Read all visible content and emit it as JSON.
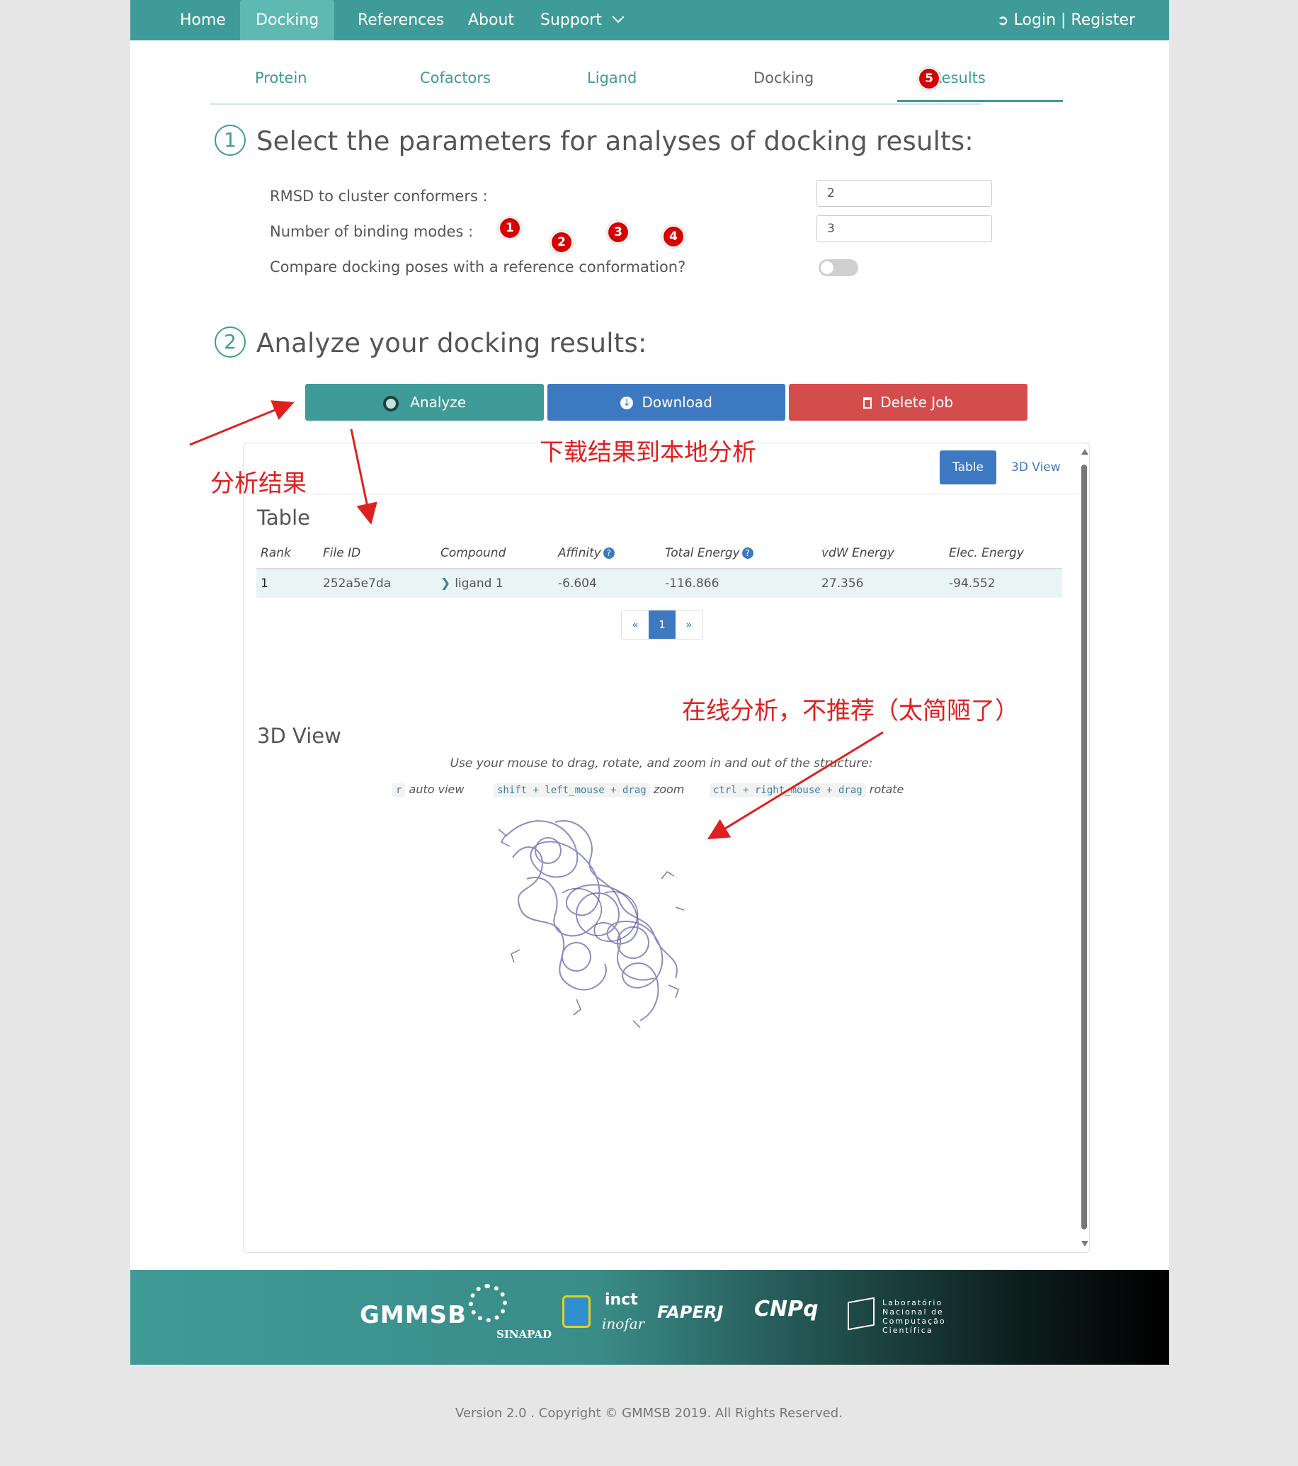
{
  "nav": {
    "items": [
      "Home",
      "Docking",
      "References",
      "About",
      "Support"
    ],
    "login": "Login | Register"
  },
  "steps": [
    "Protein",
    "Cofactors",
    "Ligand",
    "Docking",
    "Results"
  ],
  "section1": {
    "number": "1",
    "title": "Select the parameters for analyses of docking results:"
  },
  "params": {
    "rmsd_label": "RMSD to cluster conformers :",
    "rmsd_value": "2",
    "modes_label": "Number of binding modes :",
    "modes_value": "3",
    "compare_label": "Compare docking poses with a reference conformation?"
  },
  "section2": {
    "number": "2",
    "title": "Analyze your docking results:"
  },
  "buttons": {
    "analyze": "Analyze",
    "download": "Download",
    "delete": "Delete Job"
  },
  "panel": {
    "tab_table": "Table",
    "tab_3d": "3D View",
    "table_heading": "Table",
    "columns": [
      "Rank",
      "File ID",
      "Compound",
      "Affinity",
      "Total Energy",
      "vdW Energy",
      "Elec. Energy"
    ],
    "row": {
      "rank": "1",
      "file_id": "252a5e7da",
      "compound": "ligand 1",
      "affinity": "-6.604",
      "total": "-116.866",
      "vdw": "27.356",
      "elec": "-94.552"
    },
    "pager": {
      "prev": "«",
      "page": "1",
      "next": "»"
    },
    "view_heading": "3D View",
    "hint": "Use your mouse to drag, rotate, and zoom in and out of the structure:",
    "key_r": "r",
    "key_r_label": "auto view",
    "key_zoom": "shift + left_mouse + drag",
    "key_zoom_label": "zoom",
    "key_rotate": "ctrl + right_mouse + drag",
    "key_rotate_label": "rotate"
  },
  "footer": {
    "logos": [
      "GMMSB",
      "SINAPAD",
      "inct",
      "inofar",
      "FAPERJ",
      "CNPq",
      "Laboratório Nacional de Computação Científica"
    ],
    "copyright": "Version 2.0 . Copyright © GMMSB 2019. All Rights Reserved."
  },
  "annotations": {
    "badges": [
      "1",
      "2",
      "3",
      "4",
      "5"
    ],
    "analyze_note": "分析结果",
    "download_note": "下载结果到本地分析",
    "online_note": "在线分析，不推荐（太简陋了）"
  },
  "colors": {
    "teal": "#3f9b97",
    "blue": "#3d79c0",
    "red": "#d44d4d",
    "annotation_red": "#e0201f"
  }
}
